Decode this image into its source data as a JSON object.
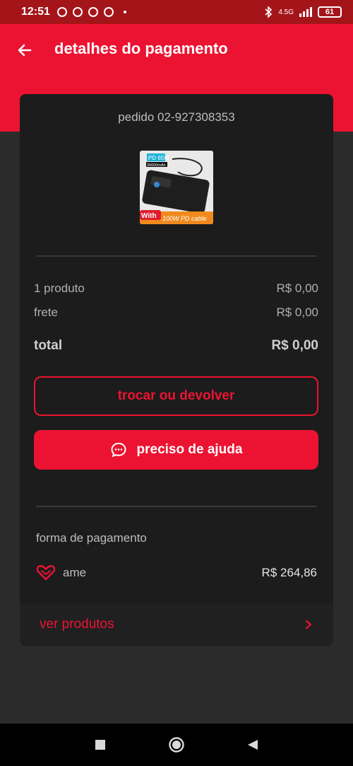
{
  "status_bar": {
    "time": "12:51",
    "network": "4.5G",
    "battery": "61"
  },
  "header": {
    "title": "detalhes do pagamento"
  },
  "order": {
    "id_label": "pedido 02-927308353",
    "image_badge_top": "PD 65W",
    "image_badge_capacity": "30000mAh",
    "image_with": "With",
    "image_cable": "100W PD cable"
  },
  "summary": {
    "products_label": "1 produto",
    "products_value": "R$ 0,00",
    "shipping_label": "frete",
    "shipping_value": "R$ 0,00",
    "total_label": "total",
    "total_value": "R$ 0,00"
  },
  "actions": {
    "exchange_label": "trocar ou devolver",
    "help_label": "preciso de ajuda"
  },
  "payment": {
    "section_label": "forma de pagamento",
    "method_name": "ame",
    "method_value": "R$ 264,86"
  },
  "footer_link": {
    "label": "ver produtos"
  },
  "colors": {
    "accent": "#ec1332",
    "status_bar": "#a4151a",
    "card": "#1c1c1c",
    "background": "#2b2b2b"
  }
}
